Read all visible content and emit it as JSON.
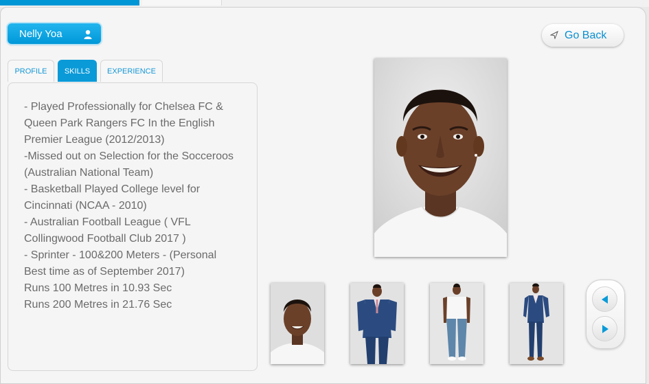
{
  "header": {
    "profile_name": "Nelly Yoa",
    "user_icon": "user-icon",
    "go_back_label": "Go Back",
    "go_back_icon": "arrow-pointer-icon"
  },
  "tabs": [
    {
      "label": "PROFILE",
      "active": false
    },
    {
      "label": "SKILLS",
      "active": true
    },
    {
      "label": "EXPERIENCE",
      "active": false
    }
  ],
  "skills": {
    "lines": [
      "- Played Professionally for Chelsea FC &",
      "Queen Park Rangers FC In the English",
      "Premier League (2012/2013)",
      "-Missed out on Selection for the Socceroos",
      "(Australian National Team)",
      "- Basketball Played College level for",
      "Cincinnati (NCAA - 2010)",
      "- Australian Football League ( VFL",
      "Collingwood Football Club 2017 )",
      "- Sprinter - 100&200 Meters - (Personal",
      "Best time as of September 2017)",
      "Runs 100 Metres in 10.93 Sec",
      "Runs 200 Metres in 21.76 Sec"
    ]
  },
  "gallery": {
    "thumbnails": [
      "headshot",
      "blue-suit-front",
      "white-tshirt-jeans",
      "blue-suit-full"
    ],
    "prev_icon": "triangle-left-icon",
    "next_icon": "triangle-right-icon"
  },
  "colors": {
    "accent": "#0a9ad8",
    "text": "#6a6a6a",
    "link": "#0a8fd1"
  }
}
